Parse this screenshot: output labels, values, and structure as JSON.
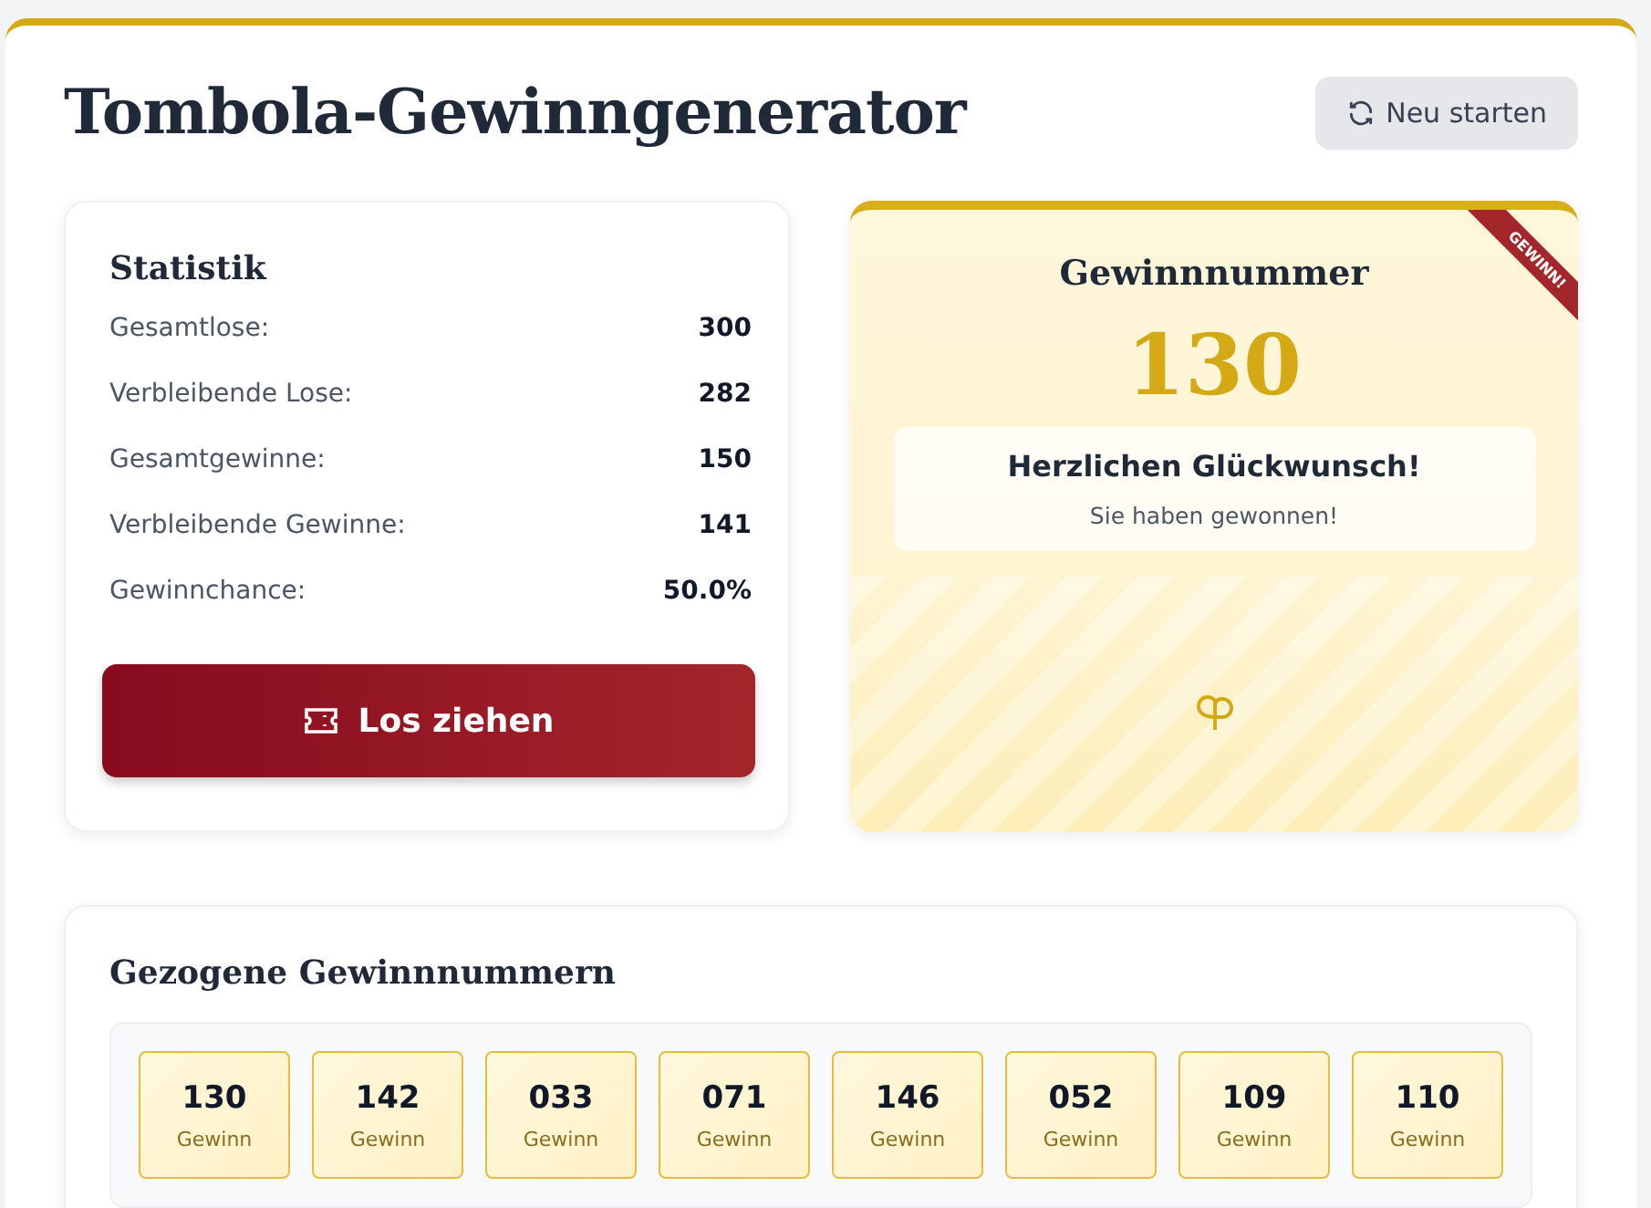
{
  "header": {
    "title": "Tombola-Gewinngenerator",
    "restart_button": "Neu starten"
  },
  "stats": {
    "title": "Statistik",
    "rows": [
      {
        "label": "Gesamtlose:",
        "value": "300"
      },
      {
        "label": "Verbleibende Lose:",
        "value": "282"
      },
      {
        "label": "Gesamtgewinne:",
        "value": "150"
      },
      {
        "label": "Verbleibende Gewinne:",
        "value": "141"
      },
      {
        "label": "Gewinnchance:",
        "value": "50.0%"
      }
    ],
    "draw_button": "Los ziehen"
  },
  "result": {
    "title": "Gewinnnummer",
    "ribbon": "GEWINN!",
    "number": "130",
    "message": "Herzlichen Glückwunsch!",
    "submessage": "Sie haben gewonnen!"
  },
  "history": {
    "title": "Gezogene Gewinnnummern",
    "tiles": [
      {
        "number": "130",
        "label": "Gewinn"
      },
      {
        "number": "142",
        "label": "Gewinn"
      },
      {
        "number": "033",
        "label": "Gewinn"
      },
      {
        "number": "071",
        "label": "Gewinn"
      },
      {
        "number": "146",
        "label": "Gewinn"
      },
      {
        "number": "052",
        "label": "Gewinn"
      },
      {
        "number": "109",
        "label": "Gewinn"
      },
      {
        "number": "110",
        "label": "Gewinn"
      }
    ]
  }
}
